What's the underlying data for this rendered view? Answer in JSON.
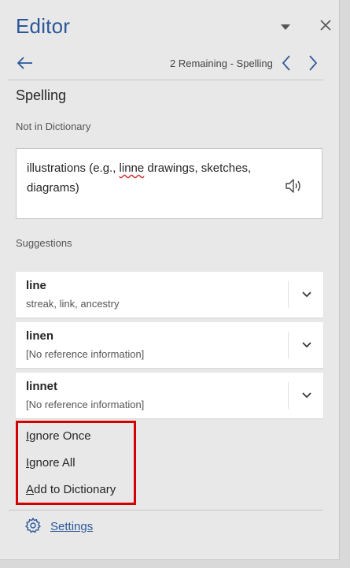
{
  "header": {
    "title": "Editor",
    "dropdown_icon": "triangle-down-icon",
    "close_icon": "close-icon"
  },
  "nav": {
    "back_icon": "arrow-left-icon",
    "remaining_text": "2 Remaining - Spelling",
    "prev_icon": "chevron-left-icon",
    "next_icon": "chevron-right-icon"
  },
  "section": {
    "title": "Spelling",
    "context_label": "Not in Dictionary",
    "context_before": "illustrations (e.g., ",
    "context_error": "linne",
    "context_after": " drawings, sketches, diagrams)",
    "speaker_icon": "speaker-icon"
  },
  "suggestions": {
    "label": "Suggestions",
    "items": [
      {
        "word": "line",
        "detail": "streak, link, ancestry"
      },
      {
        "word": "linen",
        "detail": "[No reference information]"
      },
      {
        "word": "linnet",
        "detail": "[No reference information]"
      }
    ]
  },
  "actions": {
    "ignore_once_first": "I",
    "ignore_once_rest": "gnore Once",
    "ignore_all_first": "I",
    "ignore_all_rest": "gnore All",
    "add_first": "A",
    "add_rest": "dd to Dictionary"
  },
  "footer": {
    "settings_icon": "gear-icon",
    "settings_first": "S",
    "settings_rest": "ettings"
  },
  "colors": {
    "accent": "#2b579a",
    "highlight": "#d40000",
    "pane_bg": "#e8e8e8"
  }
}
